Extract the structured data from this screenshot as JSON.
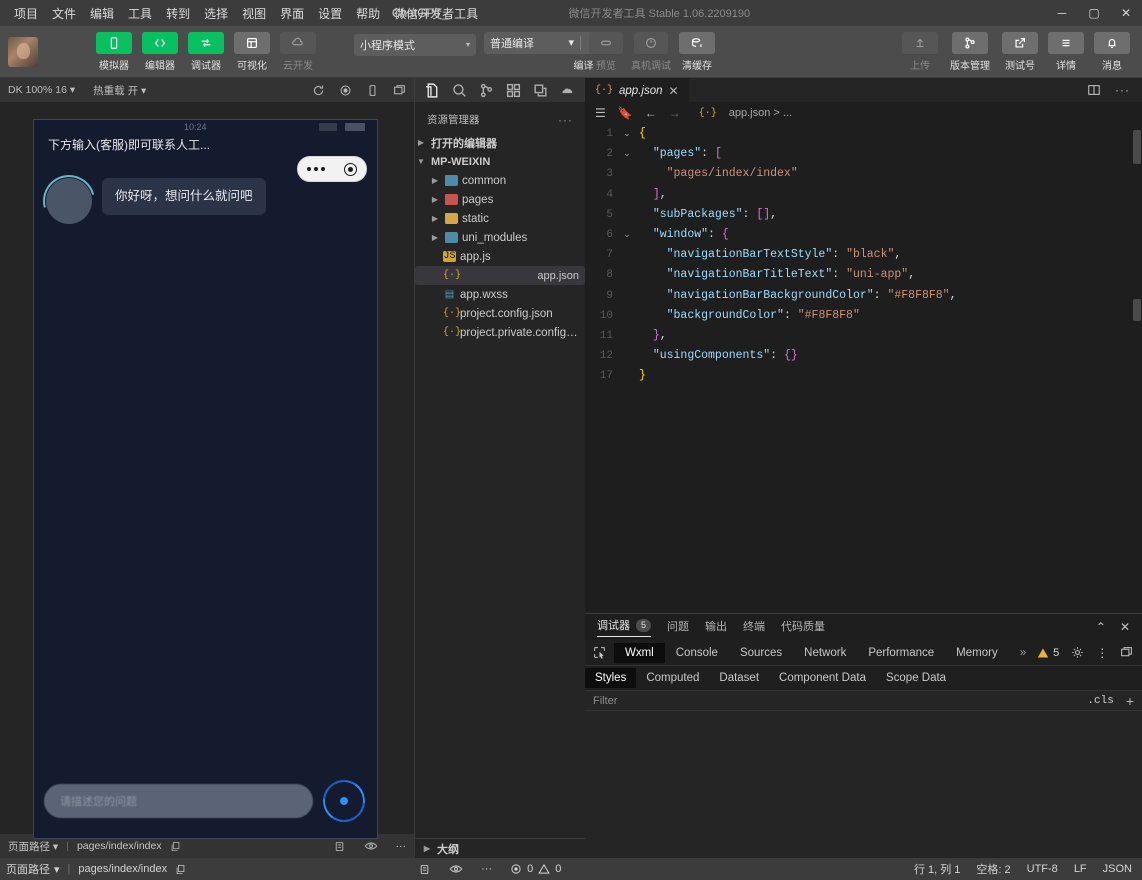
{
  "titlebar": {
    "menus": [
      "项目",
      "文件",
      "编辑",
      "工具",
      "转到",
      "选择",
      "视图",
      "界面",
      "设置",
      "帮助",
      "微信开发者工具"
    ],
    "project_name": "ChatGPT_",
    "app_title": "微信开发者工具 Stable 1.06.2209190",
    "minimize": "─",
    "maximize": "▢",
    "close": "✕"
  },
  "toolbar": {
    "left_items": [
      {
        "label": "模拟器",
        "icon": "phone-icon",
        "state": "green"
      },
      {
        "label": "编辑器",
        "icon": "code-icon",
        "state": "green"
      },
      {
        "label": "调试器",
        "icon": "debug-icon",
        "state": "green"
      },
      {
        "label": "可视化",
        "icon": "layout-icon",
        "state": "grey"
      },
      {
        "label": "云开发",
        "icon": "cloud-icon",
        "state": "disabled"
      }
    ],
    "mode_select": "小程序模式",
    "compile_select": "普通编译",
    "compile_label": "编译",
    "preview_label": "预览",
    "remote_debug_label": "真机调试",
    "clear_cache_label": "清缓存",
    "right_items": [
      {
        "label": "上传",
        "icon": "upload-icon",
        "state": "disabled"
      },
      {
        "label": "版本管理",
        "icon": "branch-icon",
        "state": "grey"
      },
      {
        "label": "测试号",
        "icon": "external-icon",
        "state": "grey"
      },
      {
        "label": "详情",
        "icon": "menu-icon",
        "state": "grey"
      },
      {
        "label": "消息",
        "icon": "bell-icon",
        "state": "grey"
      }
    ]
  },
  "simulator": {
    "toolbar": {
      "device": "DK 100% 16",
      "hot_reload": "热重载 开",
      "icons": [
        "refresh-icon",
        "record-icon",
        "rotate-icon",
        "window-icon"
      ]
    },
    "phone": {
      "nav_title": "下方输入(客服)即可联系人工...",
      "status_time": "10:24",
      "capsule_dots": "more-dots-icon",
      "capsule_target": "target-icon",
      "message": "你好呀，想问什么就问吧",
      "input_placeholder": "请描述您的问题",
      "logo": "atom-icon"
    },
    "status": {
      "page_path_label": "页面路径",
      "page_path": "pages/index/index",
      "copy_icon": "copy-icon",
      "icons": [
        "build-icon",
        "eye-icon",
        "more-icon"
      ]
    }
  },
  "activitybar": {
    "items": [
      {
        "name": "explorer-icon",
        "active": true
      },
      {
        "name": "search-icon",
        "active": false
      },
      {
        "name": "source-control-icon",
        "active": false
      },
      {
        "name": "extensions-icon",
        "active": false
      },
      {
        "name": "debug-icon",
        "active": false
      },
      {
        "name": "cloud-icon",
        "active": false
      }
    ]
  },
  "explorer": {
    "title": "资源管理器",
    "more": "···",
    "open_editors": "打开的编辑器",
    "root": "MP-WEIXIN",
    "tree": [
      {
        "label": "common",
        "type": "folder",
        "color": "blue",
        "depth": 1
      },
      {
        "label": "pages",
        "type": "folder",
        "color": "red",
        "depth": 1
      },
      {
        "label": "static",
        "type": "folder",
        "color": "yellow",
        "depth": 1
      },
      {
        "label": "uni_modules",
        "type": "folder",
        "color": "blue",
        "depth": 1
      },
      {
        "label": "app.js",
        "type": "file",
        "icon": "js",
        "depth": 1
      },
      {
        "label": "app.json",
        "type": "file",
        "icon": "json",
        "depth": 1,
        "selected": true
      },
      {
        "label": "app.wxss",
        "type": "file",
        "icon": "css",
        "depth": 1
      },
      {
        "label": "project.config.json",
        "type": "file",
        "icon": "json",
        "depth": 1
      },
      {
        "label": "project.private.config.js...",
        "type": "file",
        "icon": "json",
        "depth": 1
      }
    ],
    "outline": "大纲"
  },
  "editor": {
    "tab": {
      "name": "app.json",
      "icon": "json-icon",
      "close": "✕"
    },
    "tab_actions": [
      "split-editor-icon",
      "more-actions-icon"
    ],
    "breadcrumb_icons": [
      "outline-icon",
      "bookmark-icon",
      "back-icon",
      "forward-icon"
    ],
    "breadcrumb": "app.json > ...",
    "lines": [
      {
        "num": "1",
        "fold": "chevron-down",
        "html": "<span class='br1'>{</span>"
      },
      {
        "num": "2",
        "fold": "chevron-down",
        "html": "  <span class='k'>\"pages\"</span><span class='p'>: </span><span class='br2'>[</span>"
      },
      {
        "num": "3",
        "fold": "",
        "html": "    <span class='s'>\"pages/index/index\"</span>"
      },
      {
        "num": "4",
        "fold": "",
        "html": "  <span class='br2'>]</span><span class='p'>,</span>"
      },
      {
        "num": "5",
        "fold": "",
        "html": "  <span class='k'>\"subPackages\"</span><span class='p'>: </span><span class='br2'>[]</span><span class='p'>,</span>"
      },
      {
        "num": "6",
        "fold": "chevron-down",
        "html": "  <span class='k'>\"window\"</span><span class='p'>: </span><span class='br2'>{</span>"
      },
      {
        "num": "7",
        "fold": "",
        "html": "    <span class='k'>\"navigationBarTextStyle\"</span><span class='p'>: </span><span class='s'>\"black\"</span><span class='p'>,</span>"
      },
      {
        "num": "8",
        "fold": "",
        "html": "    <span class='k'>\"navigationBarTitleText\"</span><span class='p'>: </span><span class='s'>\"uni-app\"</span><span class='p'>,</span>"
      },
      {
        "num": "9",
        "fold": "",
        "html": "    <span class='k'>\"navigationBarBackgroundColor\"</span><span class='p'>: </span><span class='s'>\"#F8F8F8\"</span><span class='p'>,</span>"
      },
      {
        "num": "10",
        "fold": "",
        "html": "    <span class='k'>\"backgroundColor\"</span><span class='p'>: </span><span class='s'>\"#F8F8F8\"</span>"
      },
      {
        "num": "11",
        "fold": "",
        "html": "  <span class='br2'>}</span><span class='p'>,</span>"
      },
      {
        "num": "12",
        "fold": "",
        "html": "  <span class='k'>\"usingComponents\"</span><span class='p'>: </span><span class='br2'>{}</span>"
      },
      {
        "num": "17",
        "fold": "",
        "html": "<span class='br1'>}</span>"
      }
    ]
  },
  "panel": {
    "tabs": [
      {
        "label": "调试器",
        "count": "5",
        "active": true
      },
      {
        "label": "问题",
        "count": "",
        "active": false
      },
      {
        "label": "输出",
        "count": "",
        "active": false
      },
      {
        "label": "终端",
        "count": "",
        "active": false
      },
      {
        "label": "代码质量",
        "count": "",
        "active": false
      }
    ],
    "collapse": "⌃",
    "close": "✕",
    "devtools": {
      "inspect_icon": "inspect-element-icon",
      "tabs": [
        "Wxml",
        "Console",
        "Sources",
        "Network",
        "Performance",
        "Memory"
      ],
      "active_tab": "Wxml",
      "overflow": "»",
      "warning_count": "5",
      "right_icons": [
        "settings-gear-icon",
        "more-vertical-icon",
        "dock-icon"
      ]
    },
    "styles": {
      "tabs": [
        "Styles",
        "Computed",
        "Dataset",
        "Component Data",
        "Scope Data"
      ],
      "active_tab": "Styles",
      "filter_placeholder": "Filter",
      "cls_label": ".cls",
      "plus": "+"
    }
  },
  "statusbar": {
    "page_path_label": "页面路径",
    "page_path": "pages/index/index",
    "errors": "0",
    "warnings": "0",
    "line_col": "行 1, 列 1",
    "spaces": "空格: 2",
    "encoding": "UTF-8",
    "eol": "LF",
    "language": "JSON"
  },
  "colors": {
    "accent_green": "#07c160",
    "titlebar_bg": "#3c3c3c",
    "toolbar_bg": "#4c4c4c",
    "editor_bg": "#1e1e1e",
    "sidebar_bg": "#252526"
  }
}
